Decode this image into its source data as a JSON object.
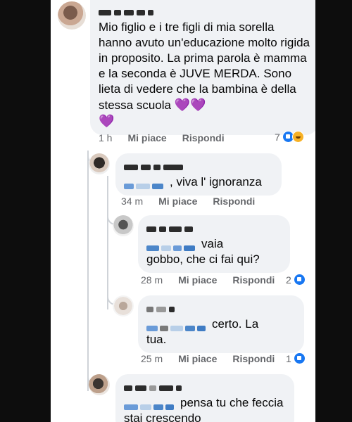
{
  "comments": [
    {
      "text": "Mio figlio e i tre figli di mia sorella hanno avuto un'educazione molto rigida in proposito. La prima parola è mamma e la seconda è JUVE MERDA. Sono lieta di vedere che la bambina è della stessa scuola",
      "hearts": "💜💜",
      "heart_extra": "💜",
      "time": "1 h",
      "like": "Mi piace",
      "reply": "Rispondi",
      "reaction_count": "7"
    },
    {
      "text": ", viva l' ignoranza",
      "time": "34 m",
      "like": "Mi piace",
      "reply": "Rispondi"
    },
    {
      "text_line1": "vaia",
      "text_line2": "gobbo, che ci fai qui?",
      "time": "28 m",
      "like": "Mi piace",
      "reply": "Rispondi",
      "reaction_count": "2"
    },
    {
      "text_line1": "certo. La",
      "text_line2": "tua.",
      "time": "25 m",
      "like": "Mi piace",
      "reply": "Rispondi",
      "reaction_count": "1"
    },
    {
      "text_line1": "pensa tu che feccia",
      "text_line2": "stai crescendo"
    }
  ],
  "colors": {
    "background": "#0d0d0d",
    "bubble": "#f0f2f5",
    "meta": "#65676b",
    "like_blue": "#1877f2"
  }
}
